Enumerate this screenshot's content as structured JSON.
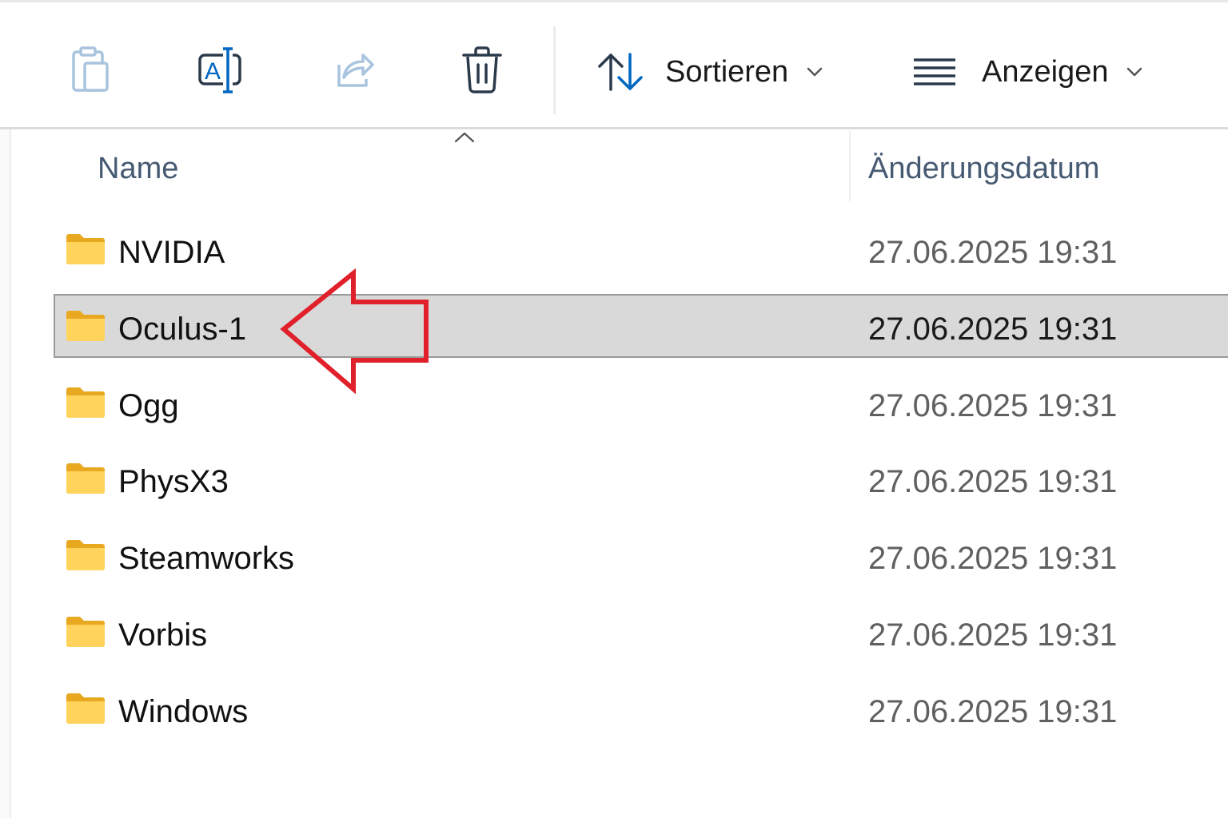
{
  "toolbar": {
    "buttons": [
      {
        "name": "paste",
        "icon": "clipboard-icon",
        "enabled": false
      },
      {
        "name": "rename",
        "icon": "rename-icon",
        "enabled": true
      },
      {
        "name": "share",
        "icon": "share-icon",
        "enabled": false
      },
      {
        "name": "delete",
        "icon": "trash-icon",
        "enabled": true
      }
    ],
    "sort_label": "Sortieren",
    "view_label": "Anzeigen"
  },
  "columns": {
    "name": "Name",
    "date": "Änderungsdatum",
    "sort_indicator": "ascending"
  },
  "rows": [
    {
      "name": "NVIDIA",
      "date": "27.06.2025 19:31",
      "selected": false
    },
    {
      "name": "Oculus-1",
      "date": "27.06.2025 19:31",
      "selected": true
    },
    {
      "name": "Ogg",
      "date": "27.06.2025 19:31",
      "selected": false
    },
    {
      "name": "PhysX3",
      "date": "27.06.2025 19:31",
      "selected": false
    },
    {
      "name": "Steamworks",
      "date": "27.06.2025 19:31",
      "selected": false
    },
    {
      "name": "Vorbis",
      "date": "27.06.2025 19:31",
      "selected": false
    },
    {
      "name": "Windows",
      "date": "27.06.2025 19:31",
      "selected": false
    }
  ],
  "annotation": {
    "type": "arrow-left",
    "color": "#e0202a",
    "points_to": "Oculus-1"
  },
  "colors": {
    "accent": "#0067c0",
    "folder": "#f8c844",
    "selection": "#d9d9d9",
    "header_text": "#465a72",
    "date_text": "#606060"
  }
}
